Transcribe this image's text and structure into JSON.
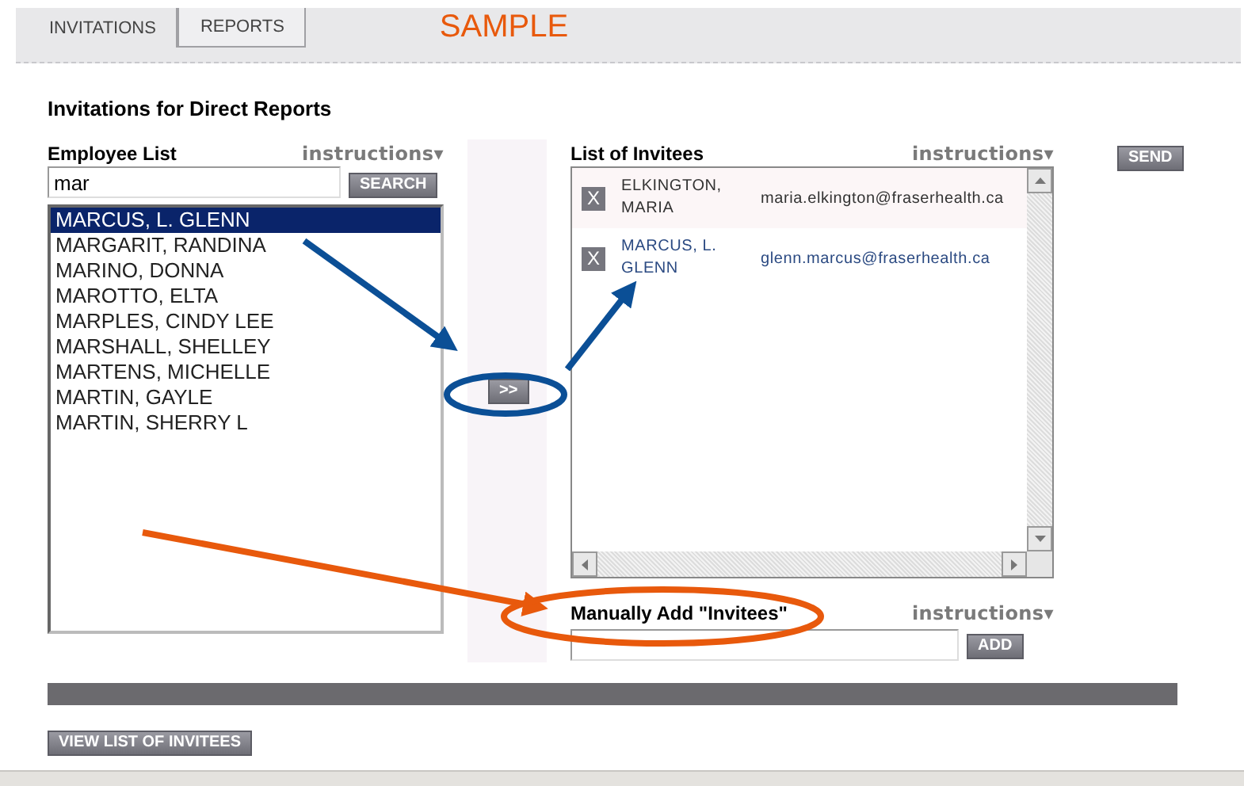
{
  "tabs": [
    {
      "label": "INVITATIONS",
      "selected": true
    },
    {
      "label": "REPORTS",
      "selected": false
    }
  ],
  "annotation_label": "SAMPLE",
  "title": "Invitations for Direct Reports",
  "employee_list": {
    "label": "Employee List",
    "instructions": "instructions▾",
    "search": {
      "value": "mar"
    },
    "search_button": "SEARCH",
    "items": [
      {
        "name": "MARCUS, L. GLENN",
        "selected": true
      },
      {
        "name": "MARGARIT, RANDINA",
        "selected": false
      },
      {
        "name": "MARINO, DONNA",
        "selected": false
      },
      {
        "name": "MAROTTO, ELTA",
        "selected": false
      },
      {
        "name": "MARPLES, CINDY LEE",
        "selected": false
      },
      {
        "name": "MARSHALL, SHELLEY",
        "selected": false
      },
      {
        "name": "MARTENS, MICHELLE",
        "selected": false
      },
      {
        "name": "MARTIN, GAYLE",
        "selected": false
      },
      {
        "name": "MARTIN, SHERRY L",
        "selected": false
      }
    ]
  },
  "move_button": ">>",
  "invitees": {
    "label": "List of Invitees",
    "instructions": "instructions▾",
    "items": [
      {
        "remove": "X",
        "name": "ELKINGTON, MARIA",
        "email": "maria.elkington@fraserhealth.ca",
        "added": false
      },
      {
        "remove": "X",
        "name": "MARCUS, L. GLENN",
        "email": "glenn.marcus@fraserhealth.ca",
        "added": true
      }
    ]
  },
  "send_button": "SEND",
  "manual_add": {
    "label": "Manually Add \"Invitees\"",
    "instructions": "instructions▾",
    "add_button": "ADD"
  },
  "view_button": "VIEW LIST OF INVITEES"
}
